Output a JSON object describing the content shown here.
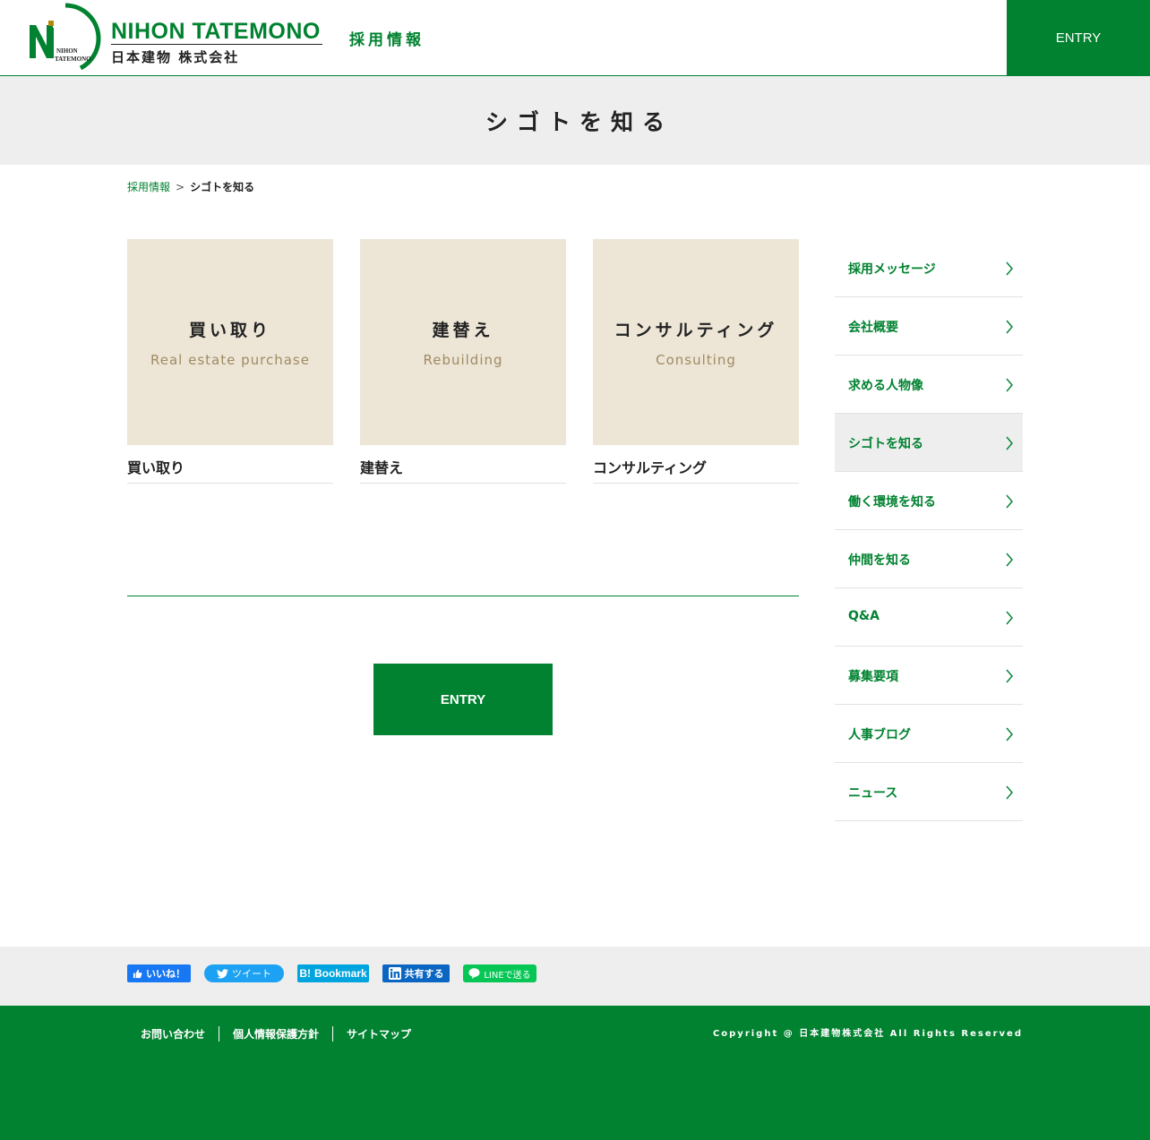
{
  "header": {
    "logo_en_first": "NIHON ",
    "logo_en_t": "T",
    "logo_en_rest": "ATEMONO",
    "logo_jp": "日本建物 株式会社",
    "logo_mark_top": "NIHON",
    "logo_mark_bottom": "TATEMONO",
    "subtitle": "採用情報",
    "entry_label": "ENTRY"
  },
  "page": {
    "title": "シゴトを知る"
  },
  "breadcrumb": {
    "home": "採用情報",
    "separator": ">",
    "current": "シゴトを知る"
  },
  "cards": [
    {
      "thumb_jp": "買い取り",
      "thumb_en": "Real estate purchase",
      "label": "買い取り"
    },
    {
      "thumb_jp": "建替え",
      "thumb_en": "Rebuilding",
      "label": "建替え"
    },
    {
      "thumb_jp": "コンサルティング",
      "thumb_en": "Consulting",
      "label": "コンサルティング"
    }
  ],
  "main": {
    "entry_label": "ENTRY"
  },
  "sidebar": {
    "items": [
      {
        "label": "採用メッセージ",
        "active": false
      },
      {
        "label": "会社概要",
        "active": false
      },
      {
        "label": "求める人物像",
        "active": false
      },
      {
        "label": "シゴトを知る",
        "active": true
      },
      {
        "label": "働く環境を知る",
        "active": false
      },
      {
        "label": "仲間を知る",
        "active": false
      },
      {
        "label": "Q&A",
        "active": false
      },
      {
        "label": "募集要項",
        "active": false
      },
      {
        "label": "人事ブログ",
        "active": false
      },
      {
        "label": "ニュース",
        "active": false
      }
    ]
  },
  "share": {
    "facebook": "いいね！",
    "twitter": "ツイート",
    "hatena": "Bookmark",
    "hatena_mark": "B!",
    "linkedin": "共有する",
    "line": "LINEで送る"
  },
  "footer": {
    "links": [
      "お問い合わせ",
      "個人情報保護方針",
      "サイトマップ"
    ],
    "copyright": "Copyright @ 日本建物株式会社 All Rights Reserved"
  },
  "colors": {
    "brand_green": "#008230",
    "band_gray": "#eeeeee",
    "card_beige": "#ede6d7",
    "card_en_brown": "#a08a62"
  }
}
